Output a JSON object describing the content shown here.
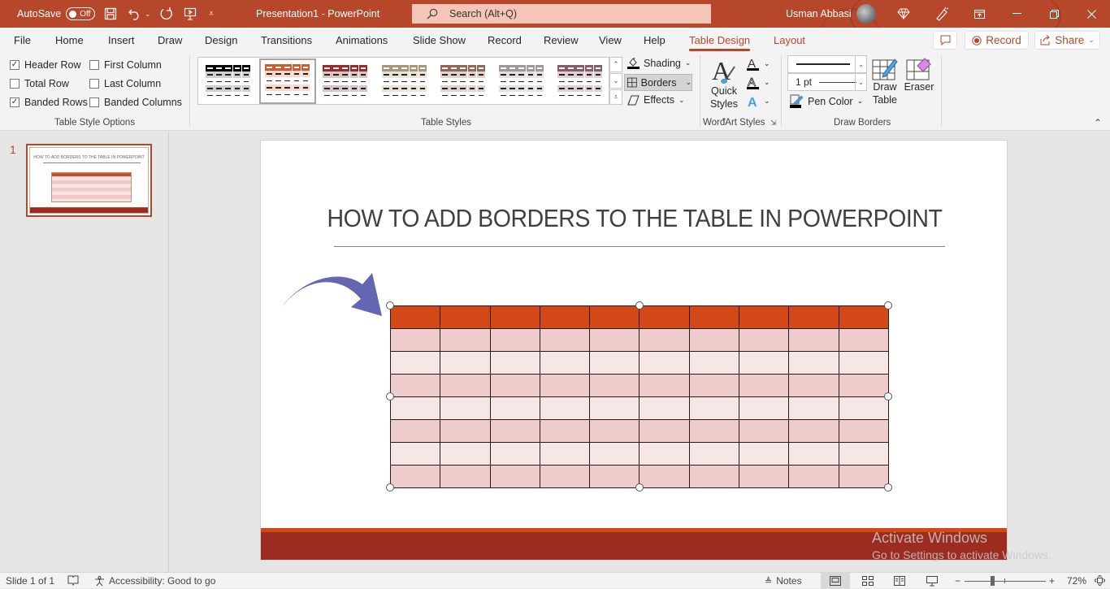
{
  "titlebar": {
    "autosave_label": "AutoSave",
    "autosave_state": "Off",
    "doc_title": "Presentation1  -  PowerPoint",
    "search_placeholder": "Search (Alt+Q)",
    "user_name": "Usman Abbasi",
    "accent_color": "#b7472a"
  },
  "menu": {
    "tabs": [
      "File",
      "Home",
      "Insert",
      "Draw",
      "Design",
      "Transitions",
      "Animations",
      "Slide Show",
      "Record",
      "Review",
      "View",
      "Help",
      "Table Design",
      "Layout"
    ],
    "active_tab": "Table Design",
    "record_label": "Record",
    "share_label": "Share"
  },
  "ribbon": {
    "table_style_options": {
      "label": "Table Style Options",
      "options": [
        {
          "label": "Header Row",
          "checked": true
        },
        {
          "label": "First Column",
          "checked": false
        },
        {
          "label": "Total Row",
          "checked": false
        },
        {
          "label": "Last Column",
          "checked": false
        },
        {
          "label": "Banded Rows",
          "checked": true
        },
        {
          "label": "Banded Columns",
          "checked": false
        }
      ]
    },
    "table_styles": {
      "label": "Table Styles",
      "swatches": [
        {
          "header": "#000000",
          "band": "#cfcfcf"
        },
        {
          "header": "#d0592e",
          "band": "#f7d6cc"
        },
        {
          "header": "#9c2b2b",
          "band": "#d8c4c4"
        },
        {
          "header": "#a99878",
          "band": "#e8e2d6"
        },
        {
          "header": "#94665a",
          "band": "#e0d2cf"
        },
        {
          "header": "#9e969a",
          "band": "#e2dfe0"
        },
        {
          "header": "#8a5a66",
          "band": "#e0d0d4"
        }
      ],
      "selected_index": 1,
      "shading_label": "Shading",
      "borders_label": "Borders",
      "effects_label": "Effects"
    },
    "wordart": {
      "label": "WordArt Styles",
      "quick_styles_line1": "Quick",
      "quick_styles_line2": "Styles"
    },
    "draw_borders": {
      "label": "Draw Borders",
      "pen_weight": "1 pt",
      "pen_color_label": "Pen Color",
      "draw_table_line1": "Draw",
      "draw_table_line2": "Table",
      "eraser_label": "Eraser"
    }
  },
  "thumbnails": [
    {
      "number": "1",
      "title": "HOW TO ADD BORDERS TO THE TABLE IN POWERPOINT"
    }
  ],
  "slide": {
    "title": "HOW TO ADD BORDERS TO THE TABLE IN POWERPOINT",
    "table": {
      "rows": 8,
      "cols": 10,
      "header_color": "#d34817",
      "band1_color": "#edcccb",
      "band2_color": "#f6e6e6",
      "border_color": "#2b1a1a"
    },
    "arrow_color": "#6466b2",
    "footer_color": "#9c2b20"
  },
  "watermark": {
    "line1": "Activate Windows",
    "line2": "Go to Settings to activate Windows."
  },
  "status": {
    "slide_counter": "Slide 1 of 1",
    "accessibility": "Accessibility: Good to go",
    "notes_label": "Notes",
    "zoom": "72%",
    "zoom_level_percent": 72
  }
}
